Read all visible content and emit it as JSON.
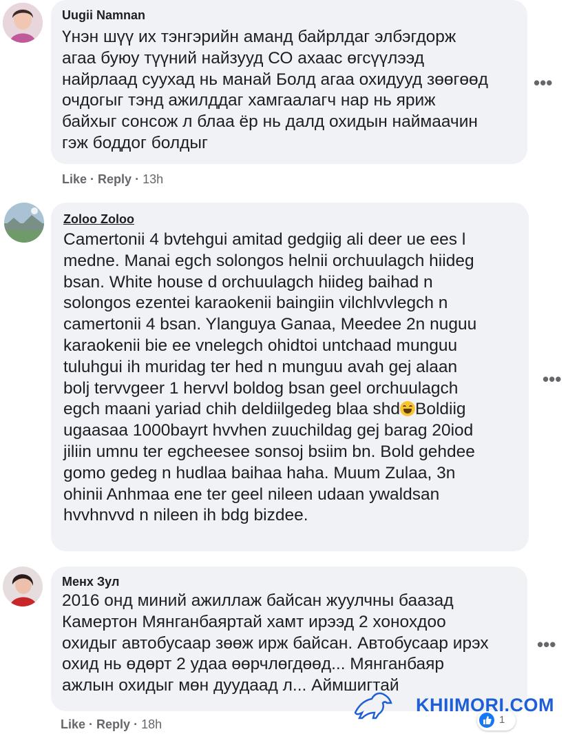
{
  "comments": [
    {
      "author": "Uugii Namnan",
      "lines": [
        "Үнэн шүү их тэнгэрийн аманд байрлдаг элбэгдорж",
        "агаа буюу түүний найзууд СО ахаас өгсүүлээд",
        "найрлаад суухад нь манай Болд агаа охидууд зөөгөөд",
        "очдогыг тэнд ажилддаг хамгаалагч нар нь яриж",
        "байхыг сонсож л блаа ёр нь далд охидын наймаачин",
        "гэж боддог болдыг"
      ],
      "like": "Like",
      "reply": "Reply",
      "time": "13h"
    },
    {
      "author": "Zoloo Zoloo",
      "lines": [
        "Camertonii 4 bvtehgui amitad gedgiig ali deer ue ees l",
        "medne. Manai egch solongos helnii orchuulagch hiideg",
        "bsan. White house d orchuulagch hiideg baihad n",
        "solongos ezentei karaokenii baingiin vilchlvvlegch n",
        "camertonii 4 bsan. Ylanguya Ganaa, Meedee 2n nuguu",
        "karaokenii bie ee vnelegch ohidtoi untchaad munguu",
        "tuluhgui ih muridag ter hed n munguu avah gej alaan",
        "bolj tervvgeer 1 hervvl boldog bsan geel orchuulagch",
        "egch maani yariad chih deldiilgedeg blaa shd",
        "ugaasaa 1000bayrt hvvhen zuuchildag gej barag 20iod",
        "jiliin umnu ter egcheesee sonsoj bsiim bn. Bold gehdee",
        "gomo gedeg n hudlaa baihaa haha. Muum Zulaa, 3n",
        "ohinii Anhmaa ene ter geel nileen udaan ywaldsan",
        "hvvhnvvd n nileen ih bdg bizdee."
      ],
      "line9_suffix": "Boldiig"
    },
    {
      "author": "Менх Зул",
      "lines": [
        "2016 онд миний ажиллаж байсан жуулчны баазад",
        "Камертон Мянганбаяртай хамт ирээд 2 хонохдоо",
        "охидыг автобусаар зөөж ирж байсан. Автобусаар ирэх",
        "охид нь өдөрт 2 удаа өөрчлөгдөөд... Мянганбаяр",
        "ажлын охидыг мөн дуудаад л... Аймшигтай"
      ],
      "like": "Like",
      "reply": "Reply",
      "time": "18h",
      "reaction_count": "1"
    }
  ],
  "more_glyph": "•••",
  "watermark": "KHIIMORI.COM",
  "colors": {
    "bubble": "#f0f2f5",
    "action_text": "#65676b",
    "watermark": "#1e5fd6",
    "like_blue": "#1877f2"
  },
  "icons": [
    "more-options-icon",
    "laughing-emoji-icon",
    "like-reaction-icon",
    "horse-logo-icon"
  ]
}
